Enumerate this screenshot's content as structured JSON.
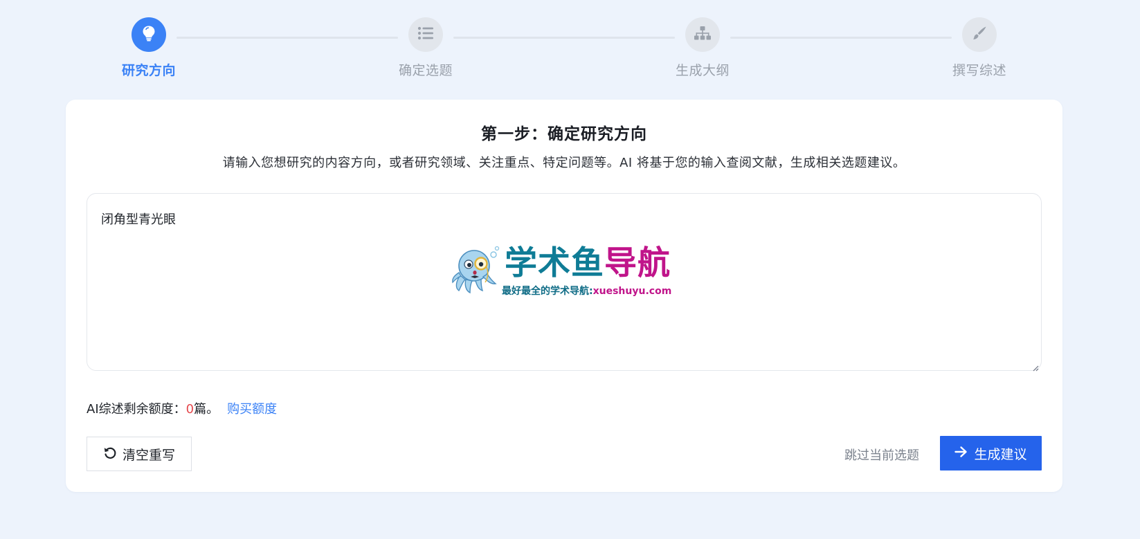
{
  "steps": [
    {
      "label": "研究方向",
      "icon": "lightbulb-icon",
      "active": true
    },
    {
      "label": "确定选题",
      "icon": "list-icon",
      "active": false
    },
    {
      "label": "生成大纲",
      "icon": "sitemap-icon",
      "active": false
    },
    {
      "label": "撰写综述",
      "icon": "pen-icon",
      "active": false
    }
  ],
  "card": {
    "title": "第一步：确定研究方向",
    "description": "请输入您想研究的内容方向，或者研究领域、关注重点、特定问题等。AI 将基于您的输入查阅文献，生成相关选题建议。",
    "input_value": "闭角型青光眼"
  },
  "watermark": {
    "title_part1": "学术鱼",
    "title_part2": "导航",
    "subtitle_part1": "最好最全的学术导航:",
    "subtitle_part2": "xueshuyu.com"
  },
  "quota": {
    "prefix": "AI综述剩余额度：",
    "count": "0",
    "suffix": "篇。",
    "buy_link": "购买额度"
  },
  "actions": {
    "reset_label": "清空重写",
    "skip_label": "跳过当前选题",
    "generate_label": "生成建议"
  },
  "colors": {
    "primary": "#3b82f6",
    "button": "#2563eb",
    "background": "#edf3fc",
    "quota_count": "#e5484d"
  }
}
